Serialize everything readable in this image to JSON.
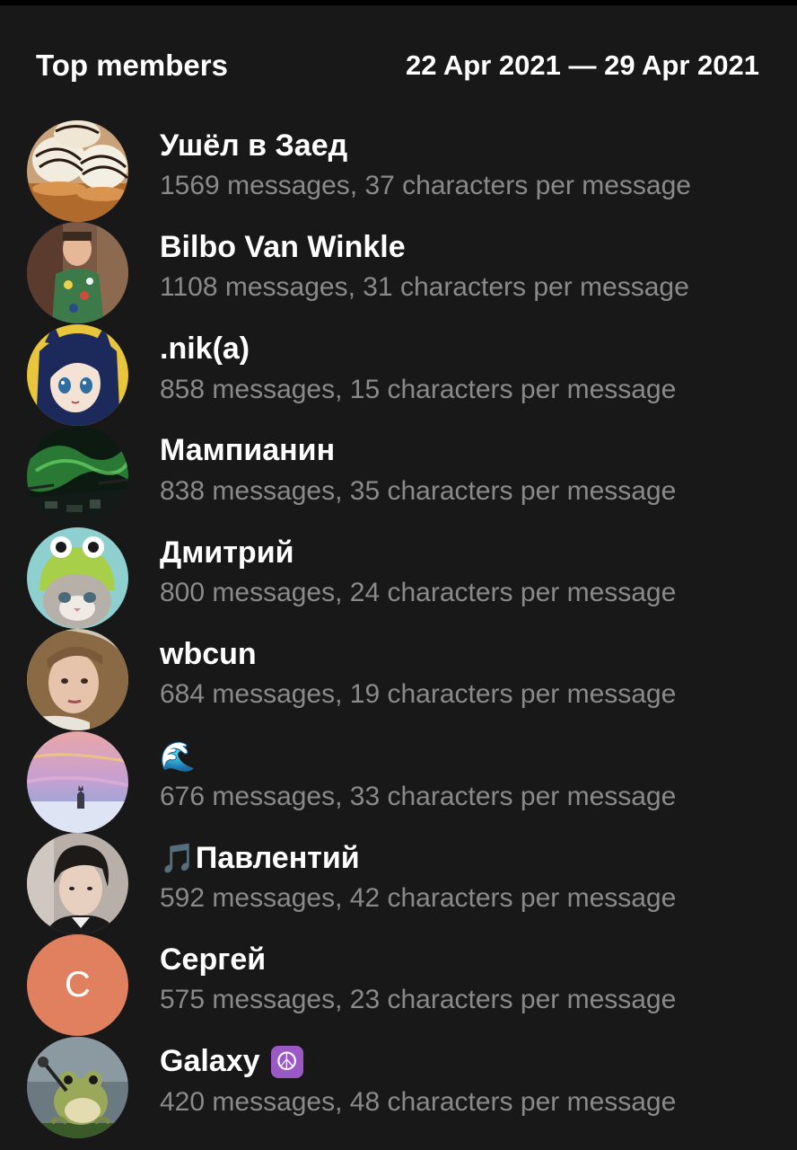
{
  "header": {
    "title": "Top members",
    "date_range": "22 Apr 2021 — 29 Apr 2021"
  },
  "members": [
    {
      "name": "Ушёл в Заед",
      "stats": "1569 messages, 37 characters per message",
      "avatar": "pastries-photo"
    },
    {
      "name": "Bilbo Van Winkle",
      "stats": "1108 messages, 31 characters per message",
      "avatar": "child-photo"
    },
    {
      "name": ".nik(a)",
      "stats": "858 messages, 15 characters per message",
      "avatar": "anime-girl-drawing"
    },
    {
      "name": "Мампианин",
      "stats": "838 messages, 35 characters per message",
      "avatar": "aurora-cockpit-photo"
    },
    {
      "name": "Дмитрий",
      "stats": "800 messages, 24 characters per message",
      "avatar": "cat-in-frog-hat-photo"
    },
    {
      "name": "wbcun",
      "stats": "684 messages, 19 characters per message",
      "avatar": "woman-portrait-photo"
    },
    {
      "name_emoji": "🌊",
      "name": "",
      "stats": "676 messages, 33 characters per message",
      "avatar": "sunset-cat-painting"
    },
    {
      "name_emoji": "🎵",
      "name": "Павлентий",
      "stats": "592 messages, 42 characters per message",
      "avatar": "man-portrait-photo"
    },
    {
      "name": "Сергей",
      "stats": "575 messages, 23 characters per message",
      "avatar_letter": "С",
      "avatar_color": "#e0805f"
    },
    {
      "name": "Galaxy",
      "name_emoji_after": "☮",
      "stats": "420 messages, 48 characters per message",
      "avatar": "frog-singing-photo"
    }
  ]
}
